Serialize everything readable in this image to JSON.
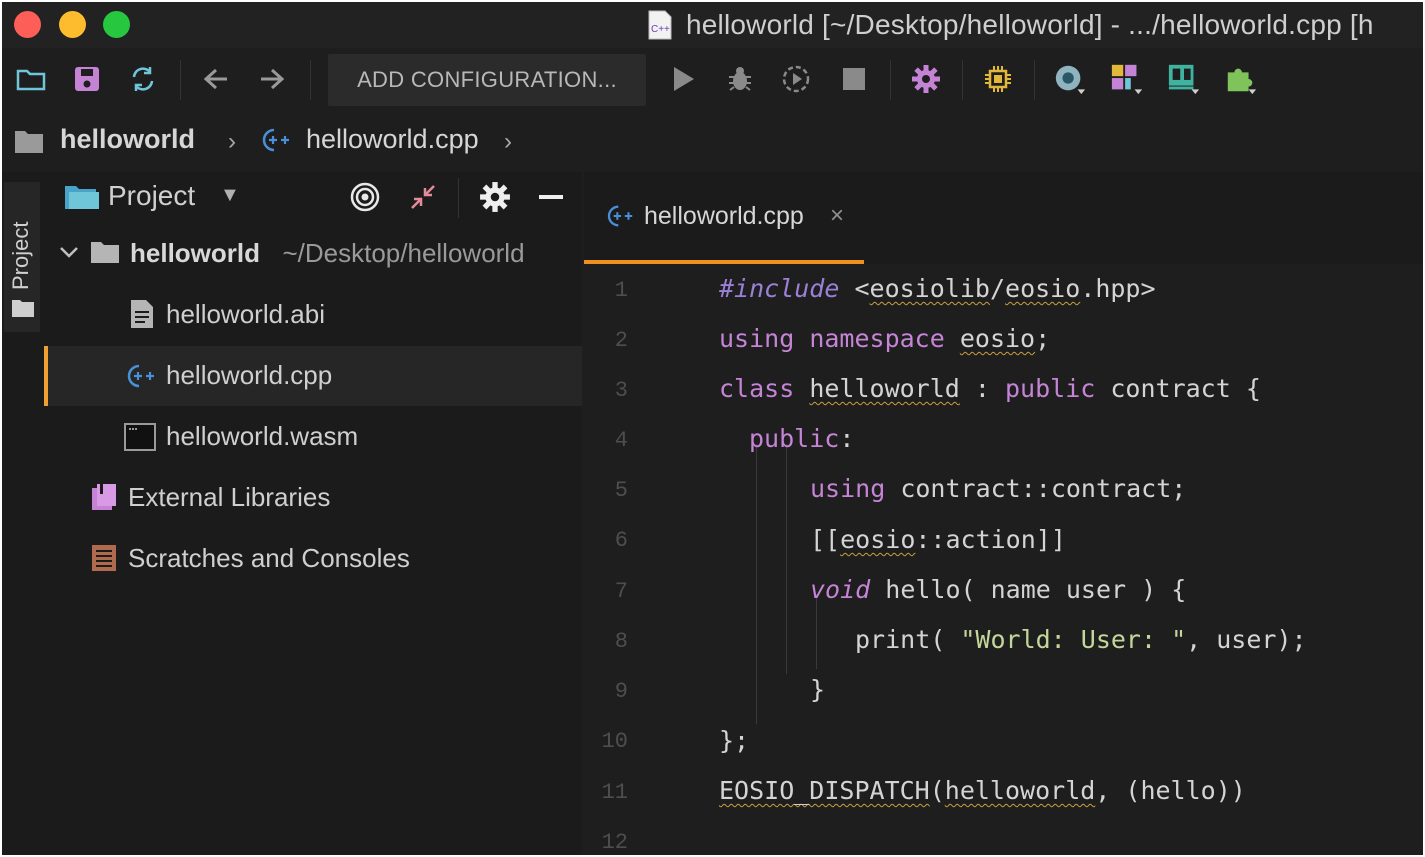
{
  "window": {
    "title": "helloworld [~/Desktop/helloworld] - .../helloworld.cpp [h",
    "title_icon_text": "C++"
  },
  "toolbar": {
    "add_configuration_label": "ADD CONFIGURATION..."
  },
  "breadcrumb": {
    "project": "helloworld",
    "file": "helloworld.cpp"
  },
  "left_stripe": {
    "label": "Project"
  },
  "project_panel": {
    "title": "Project",
    "root": {
      "name": "helloworld",
      "path": "~/Desktop/helloworld"
    },
    "files": [
      {
        "name": "helloworld.abi"
      },
      {
        "name": "helloworld.cpp"
      },
      {
        "name": "helloworld.wasm"
      }
    ],
    "extra_items": [
      {
        "name": "External Libraries"
      },
      {
        "name": "Scratches and Consoles"
      }
    ]
  },
  "editor": {
    "tab_label": "helloworld.cpp",
    "tab_close": "×",
    "line_numbers": [
      "1",
      "2",
      "3",
      "4",
      "5",
      "6",
      "7",
      "8",
      "9",
      "10",
      "11",
      "12"
    ],
    "code": {
      "l1_directive": "#include",
      "l1_lt": " <",
      "l1_lib": "eosiolib",
      "l1_slash": "/",
      "l1_eosio": "eosio",
      "l1_rest": ".hpp>",
      "l2_using": "using",
      "l2_namespace": " namespace ",
      "l2_eosio": "eosio",
      "l2_semi": ";",
      "l3_class": "class",
      "l3_name": "helloworld",
      "l3_colon": " : ",
      "l3_public": "public",
      "l3_rest": " contract {",
      "l4_public": "public",
      "l4_colon": ":",
      "l5_using": "using",
      "l5_rest": " contract::contract;",
      "l6_open": "[[",
      "l6_eosio": "eosio",
      "l6_rest": "::action]]",
      "l7_void": "void",
      "l7_rest": " hello( name user ) {",
      "l8_print": "print( ",
      "l8_str": "\"World: User: \"",
      "l8_rest": ", user);",
      "l9": "}",
      "l10": "};",
      "l11_macro": "EOSIO_DISPATCH",
      "l11_open": "(",
      "l11_name": "helloworld",
      "l11_rest": ", (hello))"
    }
  },
  "colors": {
    "accent_orange": "#f08f20",
    "keyword": "#c584d6",
    "string": "#c3d79a"
  }
}
